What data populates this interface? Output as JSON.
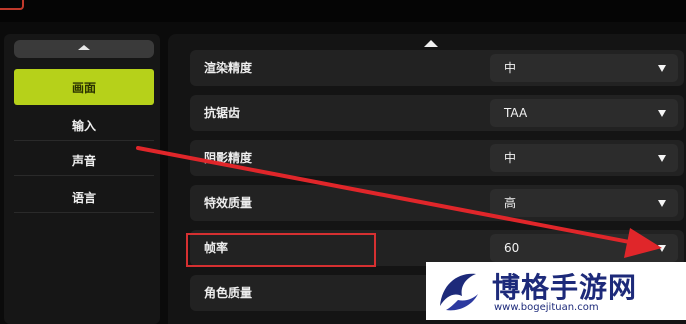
{
  "sidebar": {
    "items": [
      {
        "label": "画面",
        "active": true
      },
      {
        "label": "输入",
        "active": false
      },
      {
        "label": "声音",
        "active": false
      },
      {
        "label": "语言",
        "active": false
      }
    ]
  },
  "settings": {
    "rows": [
      {
        "label": "渲染精度",
        "value": "中"
      },
      {
        "label": "抗锯齿",
        "value": "TAA"
      },
      {
        "label": "阴影精度",
        "value": "中"
      },
      {
        "label": "特效质量",
        "value": "高"
      },
      {
        "label": "帧率",
        "value": "60"
      },
      {
        "label": "角色质量",
        "value": ""
      }
    ]
  },
  "colors": {
    "accent": "#b6d11a",
    "highlight_box": "#d63031",
    "arrow": "#e0262a"
  },
  "watermark": {
    "name": "博格手游网",
    "url": "www.bogejituan.com"
  }
}
